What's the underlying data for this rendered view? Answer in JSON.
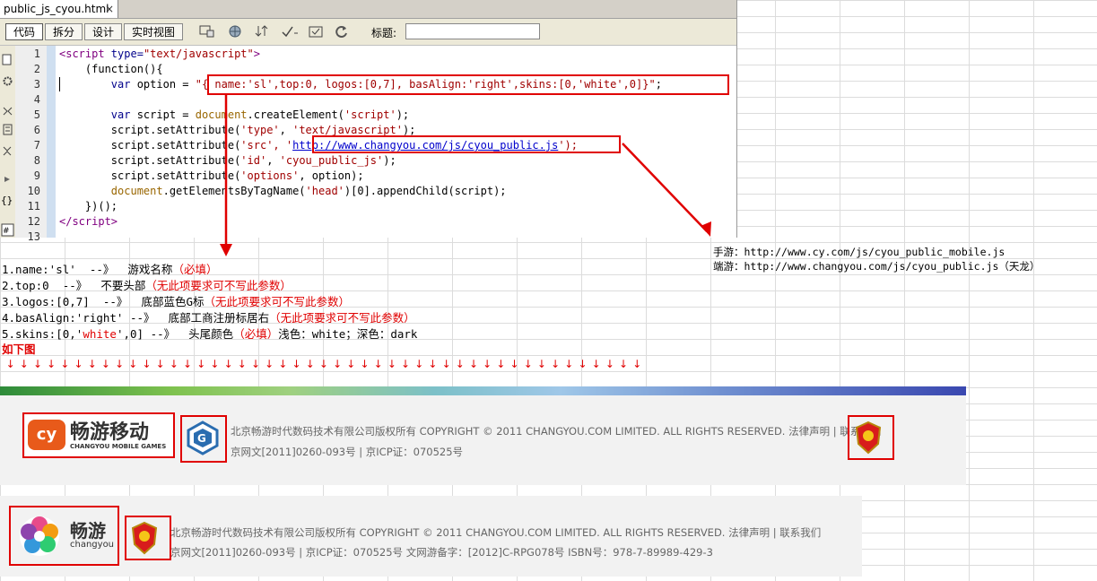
{
  "editor": {
    "tab_title": "public_js_cyou.html",
    "tab_close": "×",
    "view_buttons": [
      "代码",
      "拆分",
      "设计",
      "实时视图"
    ],
    "title_label": "标题:",
    "title_value": ""
  },
  "code": {
    "line_numbers": [
      "1",
      "2",
      "3",
      "4",
      "5",
      "6",
      "7",
      "8",
      "9",
      "10",
      "11",
      "12",
      "13"
    ],
    "lines": {
      "l1_a": "<script",
      "l1_b": " type=",
      "l1_c": "\"text/javascript\"",
      "l1_d": ">",
      "l2": "    (function(){",
      "l3_a": "        ",
      "l3_b": "var",
      "l3_c": " option = ",
      "l3_d": "\"{ name:'sl',top:0, logos:[0,7], basAlign:'right',skins:[0,'white',0]}\"",
      "l3_e": ";",
      "l5_a": "        ",
      "l5_b": "var",
      "l5_c": " script = ",
      "l5_d": "document",
      "l5_e": ".createElement(",
      "l5_f": "'script'",
      "l5_g": ");",
      "l6_a": "        script.setAttribute(",
      "l6_b": "'type'",
      "l6_c": ", ",
      "l6_d": "'text/javascript'",
      "l6_e": ");",
      "l7_a": "        script.setAttribute(",
      "l7_b": "'src'",
      "l7_c": ", '",
      "l7_d": "http://www.changyou.com/js/cyou_public.js",
      "l7_e": "');",
      "l8_a": "        script.setAttribute(",
      "l8_b": "'id'",
      "l8_c": ", ",
      "l8_d": "'cyou_public_js'",
      "l8_e": ");",
      "l9_a": "        script.setAttribute(",
      "l9_b": "'options'",
      "l9_c": ", option);",
      "l10_a": "        ",
      "l10_b": "document",
      "l10_c": ".getElementsByTagName(",
      "l10_d": "'head'",
      "l10_e": ")[0].appendChild(script);",
      "l11": "    })();",
      "l12_a": "</script",
      "l12_b": ">"
    }
  },
  "url_notes": {
    "mobile": "手游：http://www.cy.com/js/cyou_public_mobile.js",
    "pc": "端游：http://www.changyou.com/js/cyou_public.js（天龙）"
  },
  "notes": {
    "n1_a": "1.name:'sl'  --》  游戏名称",
    "n1_b": "（必填）",
    "n2_a": "2.top:0  --》  不要头部",
    "n2_b": "（无此项要求可不写此参数）",
    "n3_a": "3.logos:[0,7]  --》  底部蓝色G标",
    "n3_b": "（无此项要求可不写此参数）",
    "n4_a": "4.basAlign:'right' --》  底部工商注册标居右",
    "n4_b": "（无此项要求可不写此参数）",
    "n5_a": "5.skins:[0,'",
    "n5_b": "white",
    "n5_c": "',0] --》  头尾颜色",
    "n5_d": "（必填）",
    "n5_e": "浅色：white；深色：dark",
    "below": "如下图",
    "arrow": "↓"
  },
  "footer1": {
    "logo_cn": "畅游移动",
    "logo_en": "CHANGYOU MOBILE GAMES",
    "logo_mark": "cy",
    "line1": "北京畅游时代数码技术有限公司版权所有 COPYRIGHT © 2011 CHANGYOU.COM LIMITED. ALL RIGHTS RESERVED. 法律声明 | 联系我们",
    "line2": "京网文[2011]0260-093号 | 京ICP证：070525号"
  },
  "footer2": {
    "logo_cn": "畅游",
    "logo_en": "changyou",
    "line1": "北京畅游时代数码技术有限公司版权所有 COPYRIGHT © 2011 CHANGYOU.COM LIMITED. ALL RIGHTS RESERVED. 法律声明 | 联系我们",
    "line2": "京网文[2011]0260-093号 | 京ICP证：070525号 文网游备字：[2012]C-RPG078号 ISBN号：978-7-89989-429-3"
  },
  "colors": {
    "annotation_red": "#e00000",
    "code_string": "#a00000",
    "code_keyword": "#00008b"
  }
}
